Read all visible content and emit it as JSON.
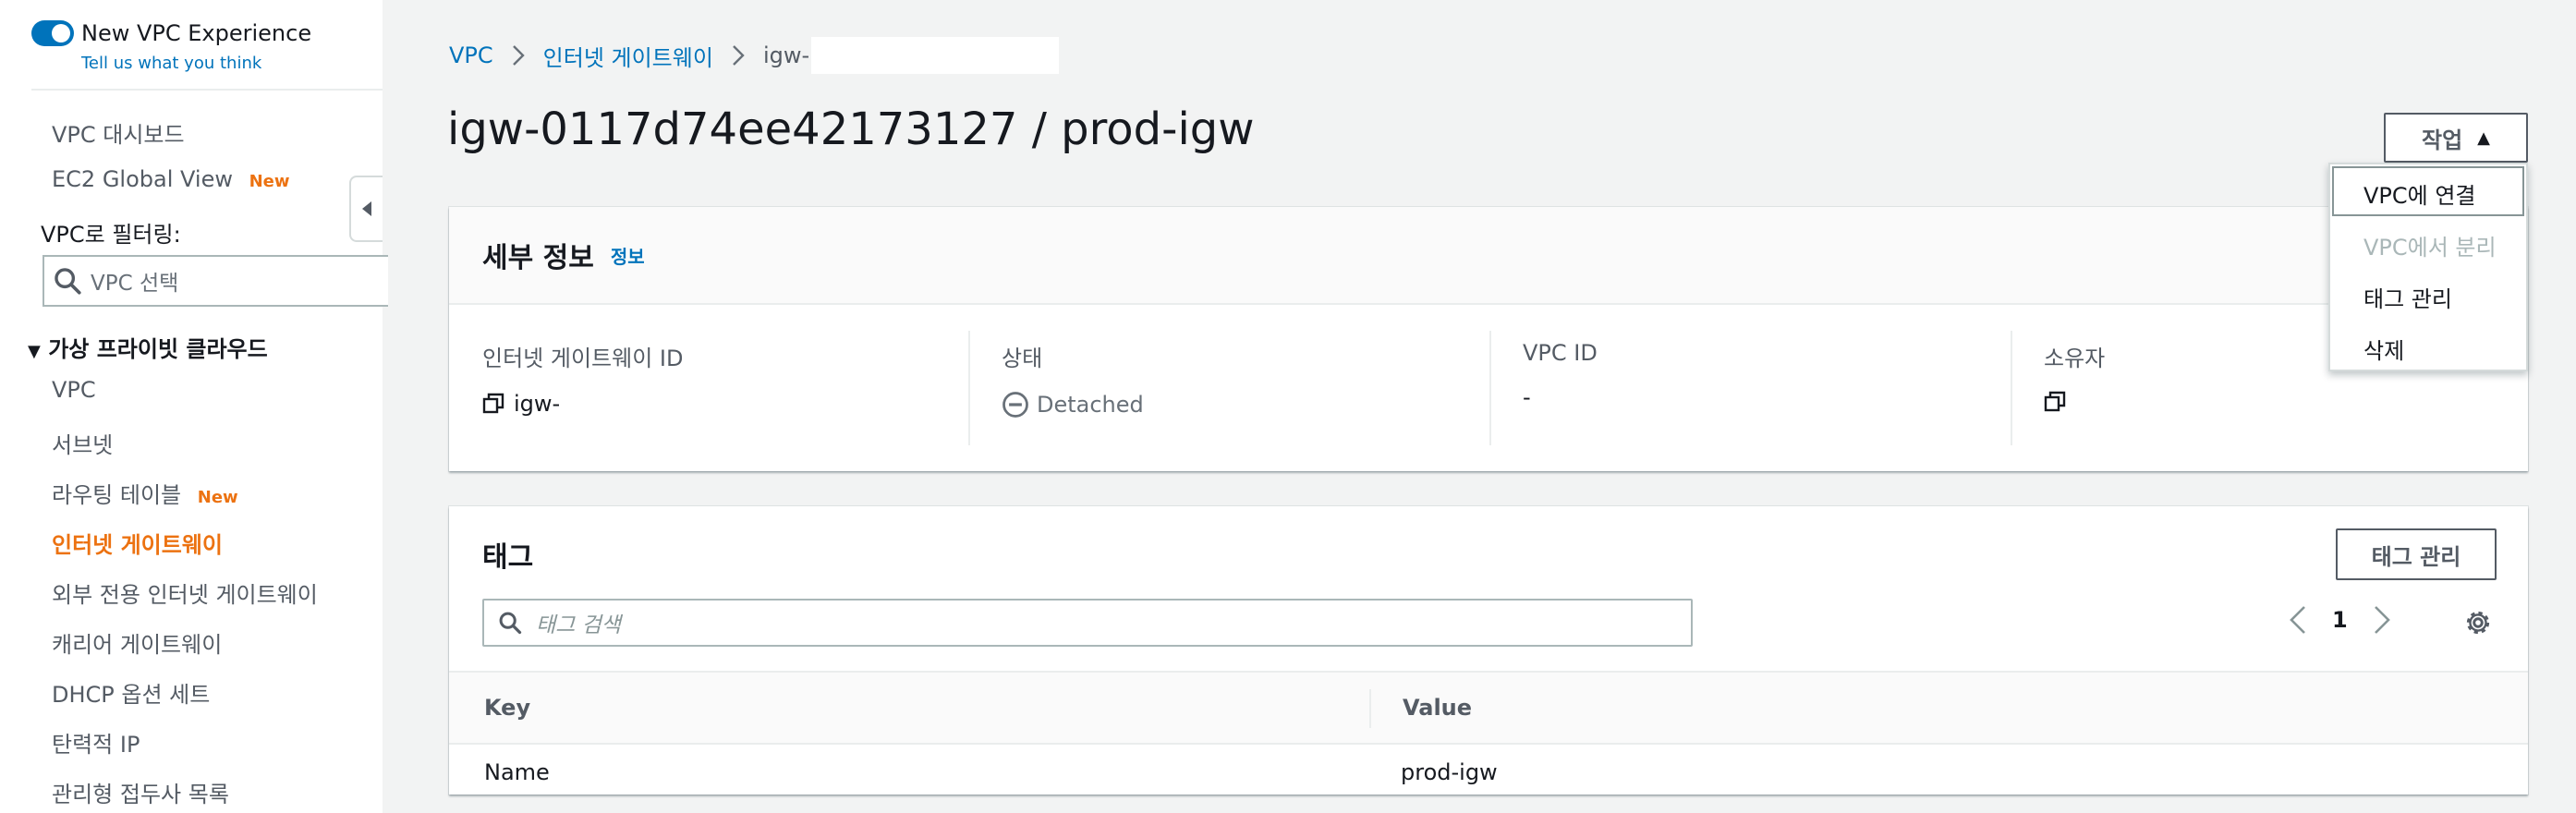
{
  "sidebar": {
    "toggle_label": "New VPC Experience",
    "feedback_link": "Tell us what you think",
    "nav_top": [
      {
        "label": "VPC 대시보드"
      },
      {
        "label": "EC2 Global View",
        "badge": "New"
      }
    ],
    "filter_label": "VPC로 필터링:",
    "filter_placeholder": "VPC 선택",
    "section_title": "가상 프라이빗 클라우드",
    "items": [
      {
        "label": "VPC"
      },
      {
        "label": "서브넷"
      },
      {
        "label": "라우팅 테이블",
        "badge": "New"
      },
      {
        "label": "인터넷 게이트웨이",
        "active": true
      },
      {
        "label": "외부 전용 인터넷 게이트웨이"
      },
      {
        "label": "캐리어 게이트웨이"
      },
      {
        "label": "DHCP 옵션 세트"
      },
      {
        "label": "탄력적 IP"
      },
      {
        "label": "관리형 접두사 목록"
      }
    ]
  },
  "breadcrumb": {
    "root": "VPC",
    "section": "인터넷 게이트웨이",
    "current": "igw-"
  },
  "page": {
    "title": "igw-0117d74ee42173127 / prod-igw",
    "actions_label": "작업"
  },
  "actions_menu": [
    {
      "label": "VPC에 연결",
      "disabled": false
    },
    {
      "label": "VPC에서 분리",
      "disabled": true
    },
    {
      "label": "태그 관리",
      "disabled": false
    },
    {
      "label": "삭제",
      "disabled": false
    }
  ],
  "details": {
    "title": "세부 정보",
    "info_link": "정보",
    "fields": [
      {
        "label": "인터넷 게이트웨이 ID",
        "value": "igw-"
      },
      {
        "label": "상태",
        "value": "Detached"
      },
      {
        "label": "VPC ID",
        "value": "-"
      },
      {
        "label": "소유자",
        "value": ""
      }
    ]
  },
  "tags": {
    "title": "태그",
    "manage_button": "태그 관리",
    "search_placeholder": "태그 검색",
    "page_number": "1",
    "columns": [
      "Key",
      "Value"
    ],
    "rows": [
      {
        "key": "Name",
        "value": "prod-igw"
      }
    ]
  },
  "colors": {
    "link": "#0073bb",
    "active": "#ec7211",
    "background": "#f2f3f3"
  }
}
